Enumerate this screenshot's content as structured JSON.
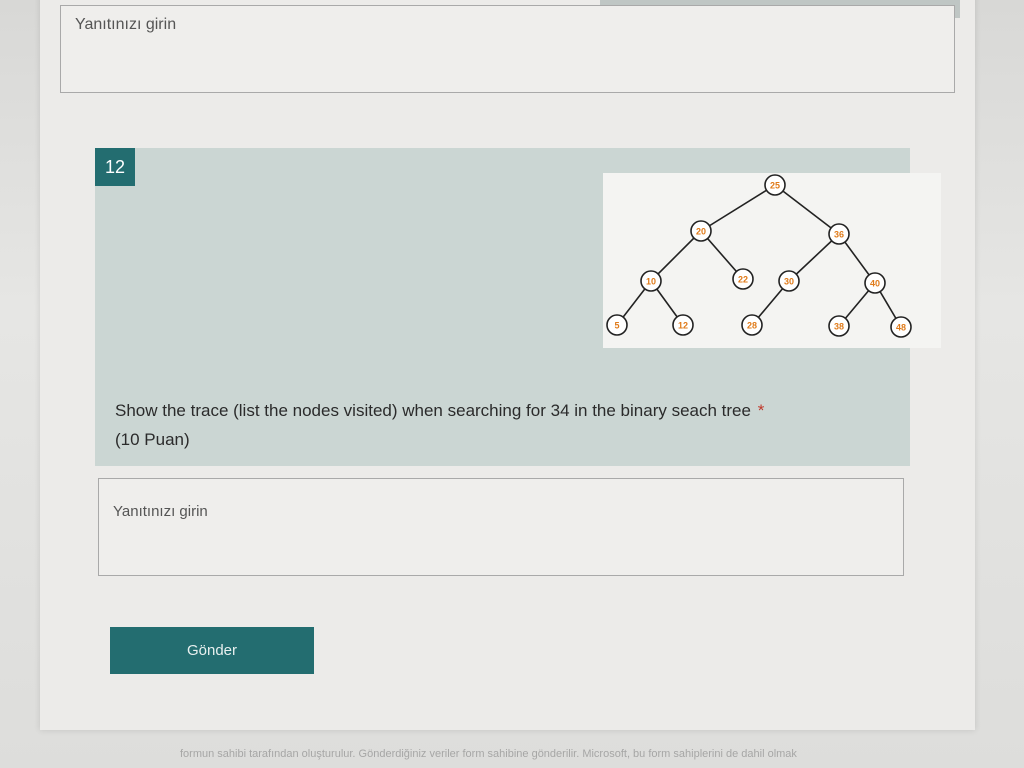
{
  "previous_question": {
    "answer_placeholder": "Yanıtınızı girin"
  },
  "question": {
    "number": "12",
    "text": "Show the trace (list the nodes visited) when searching for 34 in the binary seach tree",
    "required_mark": "*",
    "points": "(10 Puan)",
    "answer_placeholder": "Yanıtınızı girin"
  },
  "tree": {
    "node_color": "#e07b1a",
    "nodes": [
      {
        "value": "25"
      },
      {
        "value": "20"
      },
      {
        "value": "36"
      },
      {
        "value": "10"
      },
      {
        "value": "22"
      },
      {
        "value": "30"
      },
      {
        "value": "40"
      },
      {
        "value": "5"
      },
      {
        "value": "12"
      },
      {
        "value": "28"
      },
      {
        "value": "38"
      },
      {
        "value": "48"
      }
    ]
  },
  "submit": {
    "label": "Gönder"
  },
  "footer": {
    "text": "formun sahibi tarafından oluşturulur. Gönderdiğiniz veriler form sahibine gönderilir. Microsoft, bu form sahiplerini de dahil olmak"
  }
}
